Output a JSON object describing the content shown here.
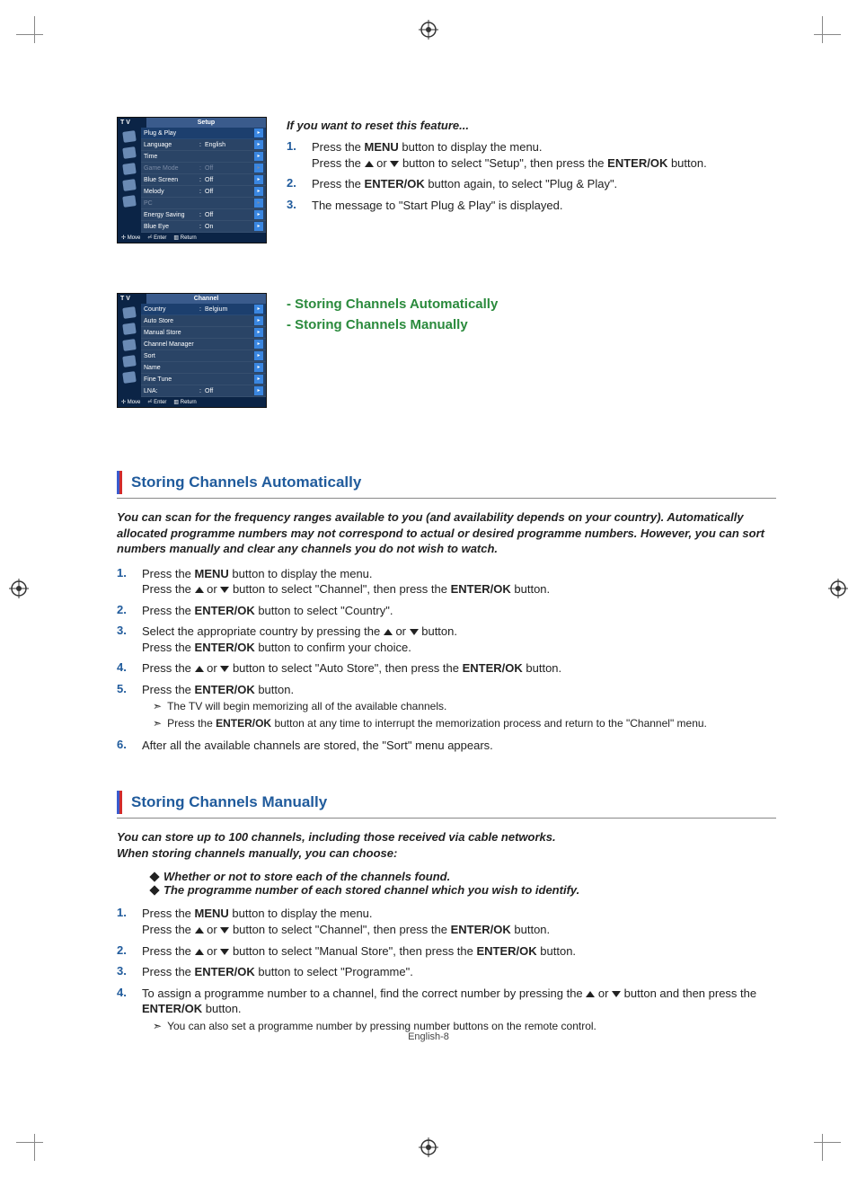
{
  "reset": {
    "heading": "If you want to reset this feature...",
    "steps": [
      {
        "n": "1.",
        "lines": [
          [
            "Press the ",
            {
              "b": "MENU"
            },
            " button to display the menu."
          ],
          [
            "Press the ",
            {
              "tri": "up"
            },
            " or ",
            {
              "tri": "down"
            },
            " button to select \"Setup\", then press the ",
            {
              "b": "ENTER/OK"
            },
            " button."
          ]
        ]
      },
      {
        "n": "2.",
        "lines": [
          [
            "Press the ",
            {
              "b": "ENTER/OK"
            },
            " button again, to select \"Plug & Play\"."
          ]
        ]
      },
      {
        "n": "3.",
        "lines": [
          [
            "The message to \"Start Plug & Play\" is displayed."
          ]
        ]
      }
    ]
  },
  "osd_setup": {
    "tv": "T V",
    "title": "Setup",
    "rows": [
      {
        "k": "Plug & Play",
        "v": "",
        "hl": true
      },
      {
        "k": "Language",
        "v": "English"
      },
      {
        "k": "Time",
        "v": ""
      },
      {
        "k": "Game Mode",
        "v": "Off",
        "dim": true
      },
      {
        "k": "Blue Screen",
        "v": "Off"
      },
      {
        "k": "Melody",
        "v": "Off"
      },
      {
        "k": "PC",
        "v": "",
        "dim": true
      },
      {
        "k": "Energy Saving",
        "v": "Off"
      },
      {
        "k": "Blue Eye",
        "v": "On"
      }
    ],
    "footer": {
      "move": "Move",
      "enter": "Enter",
      "return": "Return"
    }
  },
  "green": {
    "a": "- Storing Channels Automatically",
    "b": "- Storing Channels Manually"
  },
  "osd_channel": {
    "tv": "T V",
    "title": "Channel",
    "rows": [
      {
        "k": "Country",
        "v": "Belgium",
        "hl": true
      },
      {
        "k": "Auto Store",
        "v": ""
      },
      {
        "k": "Manual Store",
        "v": ""
      },
      {
        "k": "Channel Manager",
        "v": ""
      },
      {
        "k": "Sort",
        "v": ""
      },
      {
        "k": "Name",
        "v": ""
      },
      {
        "k": "Fine Tune",
        "v": ""
      },
      {
        "k": "LNA:",
        "v": "Off"
      }
    ],
    "footer": {
      "move": "Move",
      "enter": "Enter",
      "return": "Return"
    }
  },
  "auto_section": {
    "title": "Storing Channels Automatically",
    "intro": "You can scan for the frequency ranges available to you (and availability depends on your country). Automatically allocated programme numbers may not correspond to actual or desired programme numbers. However, you can sort numbers manually and clear any channels you do not wish to watch.",
    "steps": [
      {
        "n": "1.",
        "lines": [
          [
            "Press the ",
            {
              "b": "MENU"
            },
            " button to display the menu."
          ],
          [
            "Press the ",
            {
              "tri": "up"
            },
            " or ",
            {
              "tri": "down"
            },
            " button to select \"Channel\", then press the ",
            {
              "b": "ENTER/OK"
            },
            " button."
          ]
        ]
      },
      {
        "n": "2.",
        "lines": [
          [
            "Press the ",
            {
              "b": "ENTER/OK"
            },
            " button to select \"Country\"."
          ]
        ]
      },
      {
        "n": "3.",
        "lines": [
          [
            "Select the appropriate country by pressing the ",
            {
              "tri": "up"
            },
            " or ",
            {
              "tri": "down"
            },
            " button."
          ],
          [
            "Press the ",
            {
              "b": "ENTER/OK"
            },
            " button to confirm your choice."
          ]
        ]
      },
      {
        "n": "4.",
        "lines": [
          [
            "Press the ",
            {
              "tri": "up"
            },
            " or ",
            {
              "tri": "down"
            },
            " button to select \"Auto Store\", then press the ",
            {
              "b": "ENTER/OK"
            },
            " button."
          ]
        ]
      },
      {
        "n": "5.",
        "lines": [
          [
            "Press the ",
            {
              "b": "ENTER/OK"
            },
            " button."
          ]
        ],
        "notes": [
          [
            "The TV will begin memorizing all of the available channels."
          ],
          [
            "Press the ",
            {
              "b": "ENTER/OK"
            },
            " button at any time to interrupt the memorization process and return to the \"Channel\" menu."
          ]
        ]
      },
      {
        "n": "6.",
        "lines": [
          [
            "After all the available channels are stored, the \"Sort\" menu appears."
          ]
        ]
      }
    ]
  },
  "manual_section": {
    "title": "Storing Channels Manually",
    "intro_lines": [
      "You can store up to 100 channels, including those received via cable networks.",
      "When storing channels manually, you can choose:"
    ],
    "intro_bullets": [
      "Whether or not to store each of the channels found.",
      "The programme number of each stored channel which you wish to identify."
    ],
    "steps": [
      {
        "n": "1.",
        "lines": [
          [
            "Press the ",
            {
              "b": "MENU"
            },
            " button to display the menu."
          ],
          [
            "Press the ",
            {
              "tri": "up"
            },
            " or ",
            {
              "tri": "down"
            },
            " button to select \"Channel\", then press the ",
            {
              "b": "ENTER/OK"
            },
            " button."
          ]
        ]
      },
      {
        "n": "2.",
        "lines": [
          [
            "Press the ",
            {
              "tri": "up"
            },
            " or ",
            {
              "tri": "down"
            },
            " button to select \"Manual Store\", then press the ",
            {
              "b": "ENTER/OK"
            },
            " button."
          ]
        ]
      },
      {
        "n": "3.",
        "lines": [
          [
            "Press the ",
            {
              "b": "ENTER/OK"
            },
            " button to select \"Programme\"."
          ]
        ]
      },
      {
        "n": "4.",
        "lines": [
          [
            "To assign a programme number to a channel, find the correct number by pressing the ",
            {
              "tri": "up"
            },
            " or ",
            {
              "tri": "down"
            },
            " button and then press the ",
            {
              "b": "ENTER/OK"
            },
            " button."
          ]
        ],
        "notes": [
          [
            "You can also set a programme number by pressing number buttons on the remote control."
          ]
        ]
      }
    ]
  },
  "footer": "English-8",
  "icons": {
    "arrow": "▸",
    "move_sym": "✢",
    "enter_sym": "⏎",
    "return_sym": "▥",
    "pointer": "➣"
  }
}
